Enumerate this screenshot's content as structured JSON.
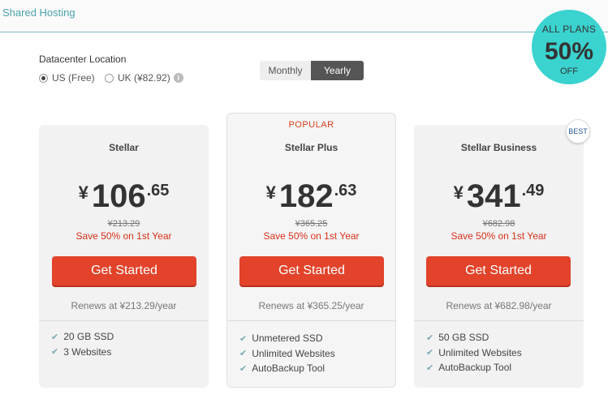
{
  "header": {
    "title": "Shared Hosting"
  },
  "promo": {
    "line1": "ALL PLANS",
    "line2": "50%",
    "line3": "OFF"
  },
  "datacenter": {
    "label": "Datacenter Location",
    "options": [
      {
        "label": "US (Free)",
        "selected": true
      },
      {
        "label": "UK (¥82.92)",
        "selected": false
      }
    ],
    "info_icon": "i"
  },
  "billing_toggle": {
    "monthly": "Monthly",
    "yearly": "Yearly",
    "selected": "Yearly"
  },
  "best_badge": "BEST",
  "plans": [
    {
      "name": "Stellar",
      "currency": "¥",
      "price_int": "106",
      "price_dec": ".65",
      "original": "¥213.29",
      "save": "Save 50% on 1st Year",
      "cta": "Get Started",
      "renews": "Renews at ¥213.29/year",
      "features": [
        "20 GB SSD",
        "3 Websites"
      ]
    },
    {
      "popular": "POPULAR",
      "name": "Stellar Plus",
      "currency": "¥",
      "price_int": "182",
      "price_dec": ".63",
      "original": "¥365.25",
      "save": "Save 50% on 1st Year",
      "cta": "Get Started",
      "renews": "Renews at ¥365.25/year",
      "features": [
        "Unmetered SSD",
        "Unlimited Websites",
        "AutoBackup Tool"
      ]
    },
    {
      "name": "Stellar Business",
      "currency": "¥",
      "price_int": "341",
      "price_dec": ".49",
      "original": "¥682.98",
      "save": "Save 50% on 1st Year",
      "cta": "Get Started",
      "renews": "Renews at ¥682.98/year",
      "features": [
        "50 GB SSD",
        "Unlimited Websites",
        "AutoBackup Tool"
      ]
    }
  ],
  "icons": {
    "check": "✔"
  },
  "colors": {
    "accent": "#e2432a",
    "badge": "#3ad3cf",
    "link": "#4aa3ab",
    "save": "#d9301a"
  }
}
